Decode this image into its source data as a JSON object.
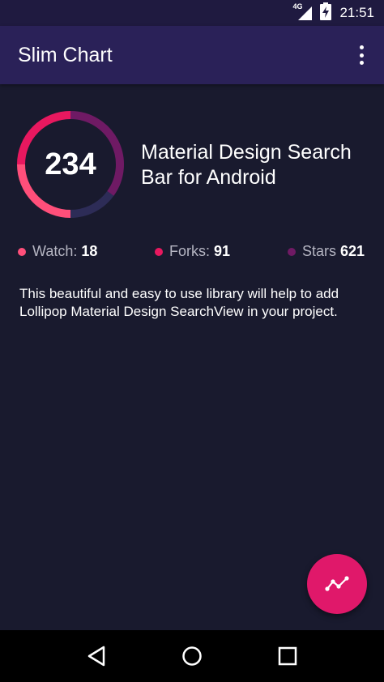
{
  "status_bar": {
    "network_label": "4G",
    "time": "21:51",
    "icons": [
      "signal-icon",
      "battery-charging-icon"
    ]
  },
  "app_bar": {
    "title": "Slim Chart",
    "menu_icon": "overflow-menu-icon"
  },
  "chart": {
    "value": "234",
    "segments": [
      {
        "fraction": 0.25,
        "color": "#e8185f"
      },
      {
        "fraction": 0.25,
        "color": "#ff4f7a"
      },
      {
        "fraction": 0.15,
        "color": "#2d2c57"
      },
      {
        "fraction": 0.35,
        "color": "#6f1a64"
      }
    ]
  },
  "repo": {
    "title": "Material Design Search Bar for Android",
    "description": "This beautiful and easy to use library will help to add Lollipop Material Design SearchView in your project."
  },
  "stats": [
    {
      "label": "Watch:",
      "value": "18",
      "color": "#ff4f7a"
    },
    {
      "label": "Forks:",
      "value": "91",
      "color": "#e8185f"
    },
    {
      "label": "Stars",
      "value": "621",
      "color": "#6f1a64"
    }
  ],
  "fab": {
    "icon": "trending-chart-icon",
    "color": "#e0186a"
  },
  "nav": {
    "icons": [
      "back-icon",
      "home-icon",
      "recents-icon"
    ]
  }
}
